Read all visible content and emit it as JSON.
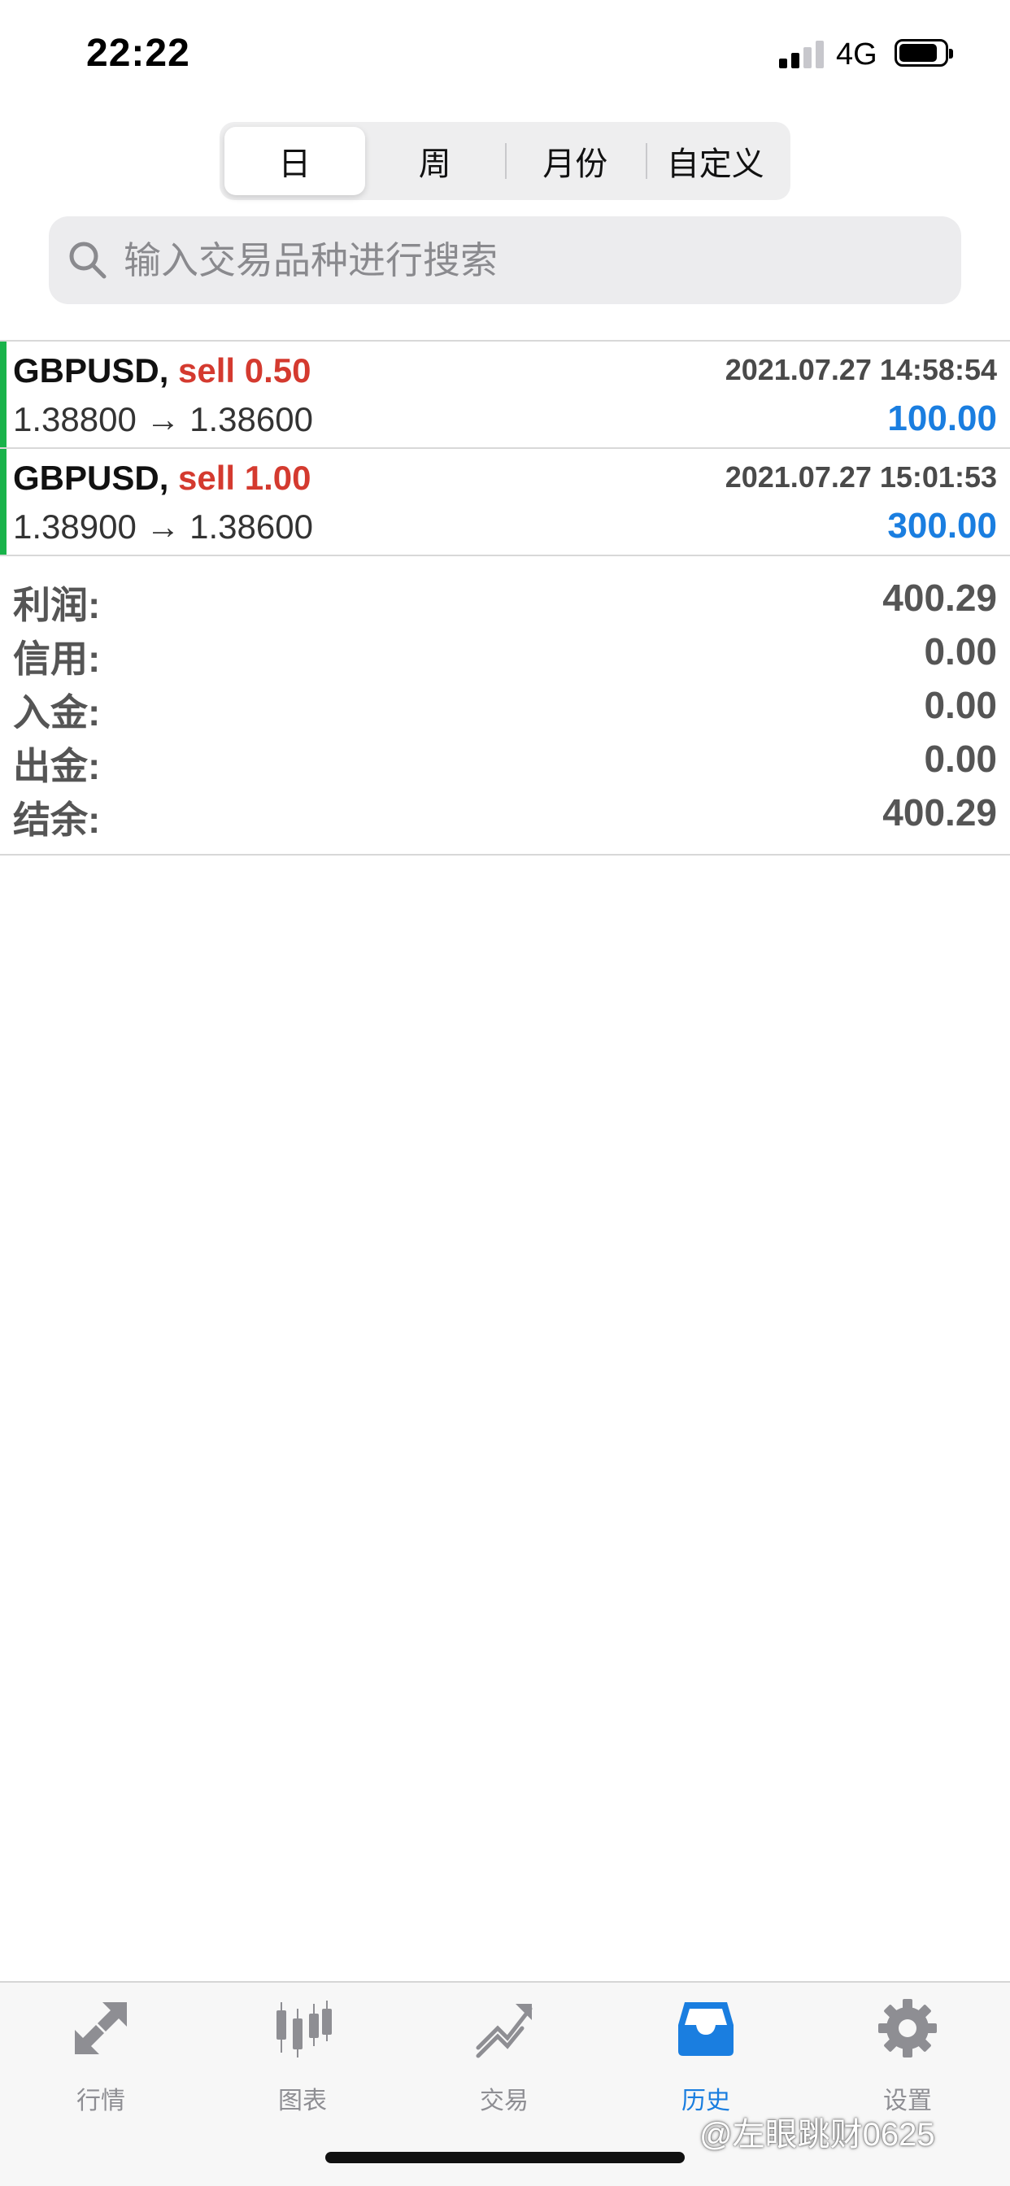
{
  "status_bar": {
    "time": "22:22",
    "network": "4G",
    "signal_level": 2,
    "signal_max": 4,
    "battery_level": 0.85
  },
  "period_tabs": [
    {
      "label": "日",
      "active": true
    },
    {
      "label": "周",
      "active": false
    },
    {
      "label": "月份",
      "active": false
    },
    {
      "label": "自定义",
      "active": false
    }
  ],
  "search": {
    "placeholder": "输入交易品种进行搜索",
    "icon": "search-icon"
  },
  "deals": [
    {
      "symbol": "GBPUSD,",
      "side": "sell 0.50",
      "time": "2021.07.27 14:58:54",
      "prices": "1.38800 → 1.38600",
      "profit": "100.00"
    },
    {
      "symbol": "GBPUSD,",
      "side": "sell 1.00",
      "time": "2021.07.27 15:01:53",
      "prices": "1.38900 → 1.38600",
      "profit": "300.00"
    }
  ],
  "summary": [
    {
      "label": "利润:",
      "value": "400.29"
    },
    {
      "label": "信用:",
      "value": "0.00"
    },
    {
      "label": "入金:",
      "value": "0.00"
    },
    {
      "label": "出金:",
      "value": "0.00"
    },
    {
      "label": "结余:",
      "value": "400.29"
    }
  ],
  "tabbar": [
    {
      "label": "行情",
      "icon": "quotes-icon",
      "active": false
    },
    {
      "label": "图表",
      "icon": "chart-icon",
      "active": false
    },
    {
      "label": "交易",
      "icon": "trade-icon",
      "active": false
    },
    {
      "label": "历史",
      "icon": "history-icon",
      "active": true
    },
    {
      "label": "设置",
      "icon": "gear-icon",
      "active": false
    }
  ],
  "colors": {
    "accent_blue": "#1a7ee0",
    "sell_red": "#d43a2f",
    "deal_bar_green": "#19b34a",
    "inactive_gray": "#8e8e93"
  },
  "watermark": "@左眼跳财0625"
}
